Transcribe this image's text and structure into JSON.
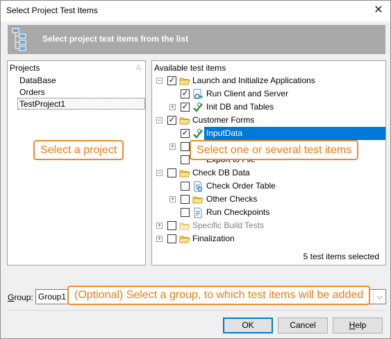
{
  "window": {
    "title": "Select Project Test Items",
    "close_glyph": "✕"
  },
  "banner": {
    "text": "Select project test items from the list"
  },
  "projects_panel": {
    "header": "Projects",
    "sort_glyph": "△",
    "items": [
      "DataBase",
      "Orders",
      "TestProject1"
    ]
  },
  "tests_panel": {
    "header": "Available test items",
    "items": [
      {
        "label": "Launch and Initialize Applications",
        "icon": "folder-icon",
        "checked": true,
        "expander": "−"
      },
      {
        "label": "Run Client and Server",
        "icon": "key-run-icon",
        "checked": true,
        "expander": ""
      },
      {
        "label": "Init DB and Tables",
        "icon": "keyword-test-icon",
        "checked": true,
        "expander": "+"
      },
      {
        "label": "Customer Forms",
        "icon": "folder-icon",
        "checked": true,
        "expander": "−"
      },
      {
        "label": "InputData",
        "icon": "keyword-test-icon",
        "checked": true,
        "expander": ""
      },
      {
        "label": "",
        "icon": "",
        "checked": false,
        "expander": "+"
      },
      {
        "label": "Export to File",
        "icon": "",
        "checked": false,
        "expander": ""
      },
      {
        "label": "Check DB Data",
        "icon": "folder-icon",
        "checked": false,
        "expander": "−"
      },
      {
        "label": "Check Order Table",
        "icon": "script-icon",
        "checked": false,
        "expander": ""
      },
      {
        "label": "Other Checks",
        "icon": "folder-icon",
        "checked": false,
        "expander": "+"
      },
      {
        "label": "Run Checkpoints",
        "icon": "script-icon",
        "checked": false,
        "expander": ""
      },
      {
        "label": "Specific Build Tests",
        "icon": "folder-icon",
        "checked": false,
        "expander": "+"
      },
      {
        "label": "Finalization",
        "icon": "folder-icon",
        "checked": false,
        "expander": "+"
      }
    ]
  },
  "callouts": {
    "project": "Select a project",
    "items": "Select one or several test items",
    "group": "(Optional) Select a group, to which test items will be added"
  },
  "status": "5 test items selected",
  "group": {
    "label": "Group:",
    "value": "Group1",
    "dropdown_glyph": "⌵"
  },
  "buttons": {
    "ok": "OK",
    "cancel": "Cancel",
    "help": "Help"
  },
  "colors": {
    "accent": "#0078d7",
    "callout": "#ef8a2a",
    "banner": "#a9a9a9"
  }
}
